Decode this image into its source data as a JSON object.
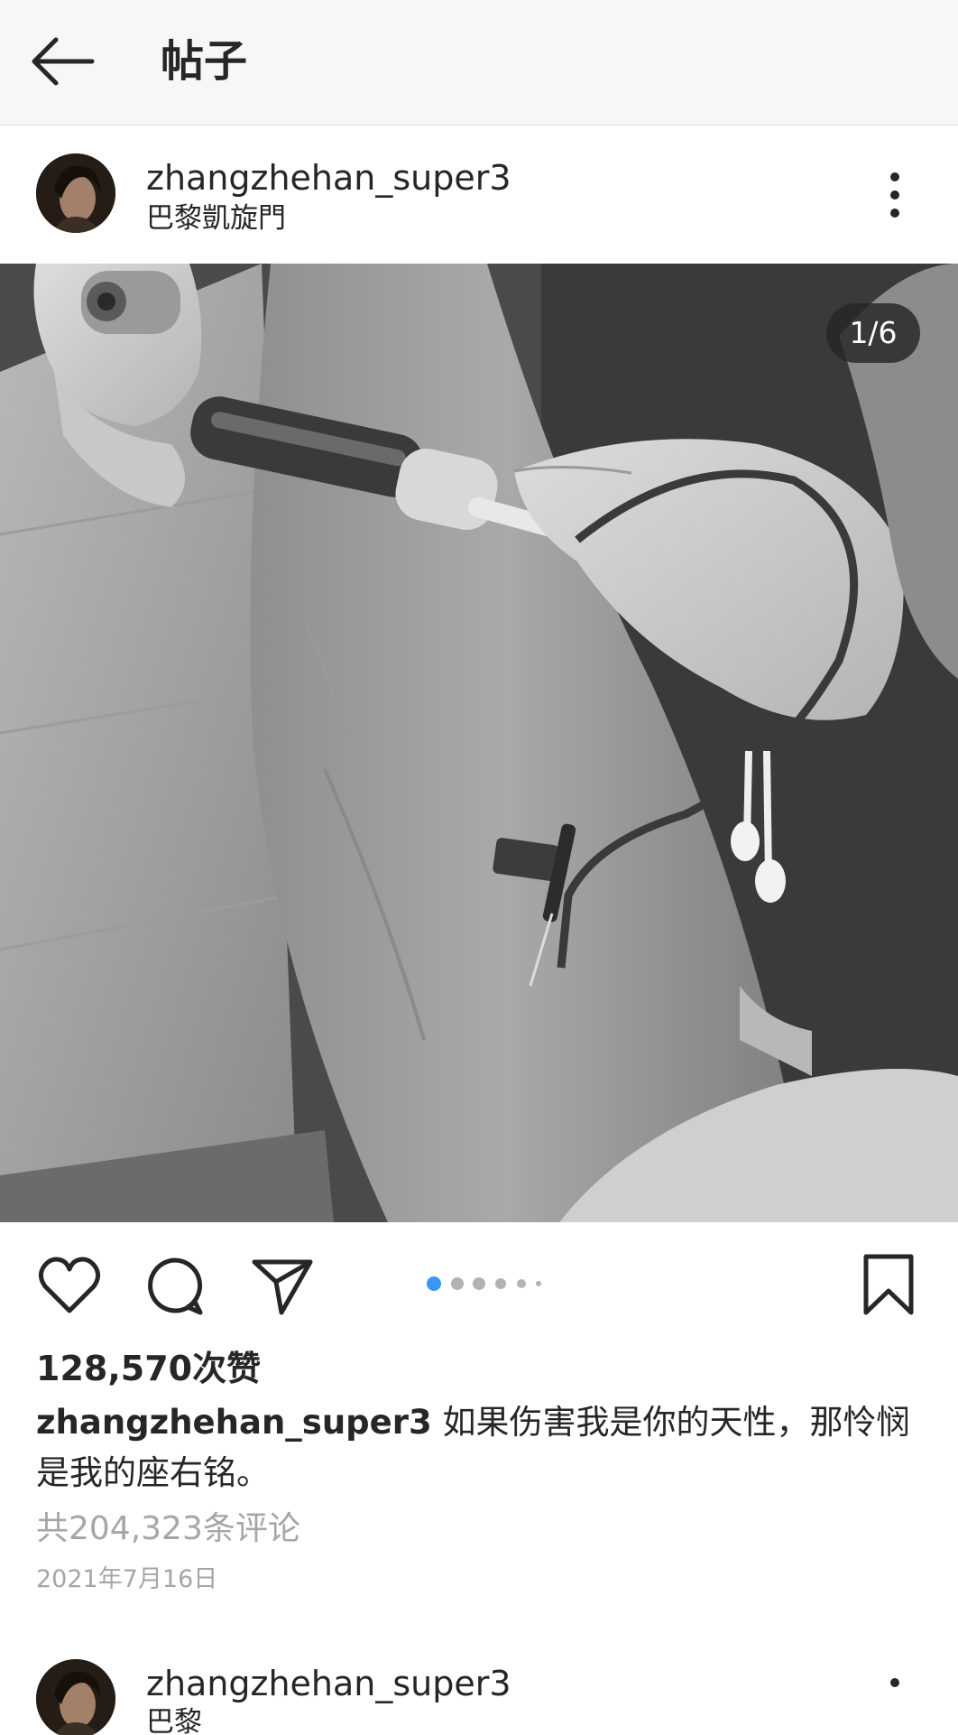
{
  "header": {
    "title": "帖子",
    "back_icon": "arrow-left-icon"
  },
  "post": {
    "username": "zhangzhehan_super3",
    "location": "巴黎凱旋門",
    "image_counter": "1/6",
    "image_content": "black-and-white photo of blood being drawn from an arm",
    "carousel": {
      "total": 6,
      "current": 1
    },
    "likes": "128,570次赞",
    "caption_username": "zhangzhehan_super3",
    "caption_text": "如果伤害我是你的天性，那怜悯是我的座右铭。",
    "comments_link": "共204,323条评论",
    "date": "2021年7月16日"
  },
  "next_post": {
    "username": "zhangzhehan_super3",
    "location": "巴黎"
  },
  "colors": {
    "accent": "#3897f0",
    "muted": "#a6a6a6",
    "text": "#262626"
  }
}
